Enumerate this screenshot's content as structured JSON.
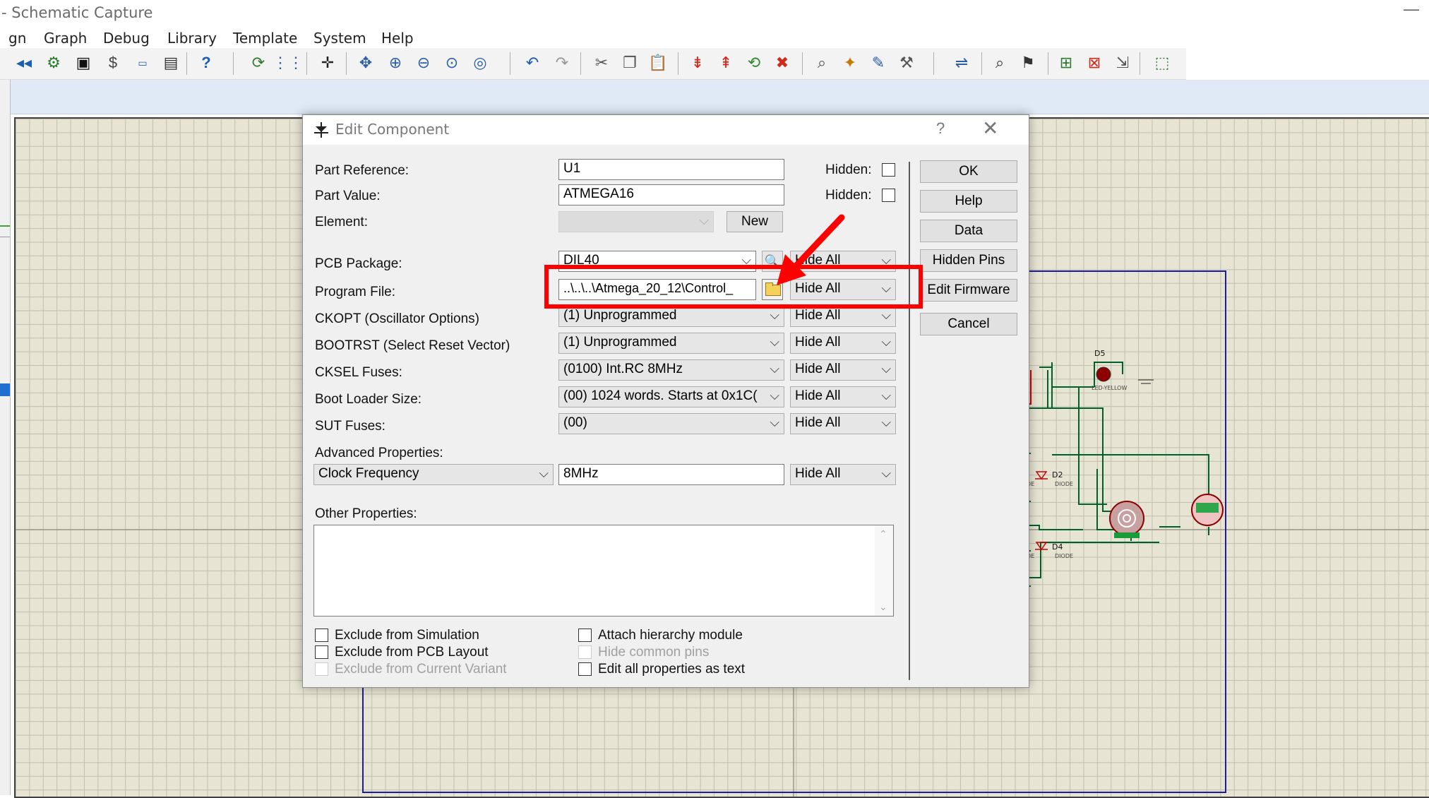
{
  "window": {
    "title": "- Schematic Capture",
    "minimize": "—"
  },
  "menu": [
    "gn",
    "Graph",
    "Debug",
    "Library",
    "Template",
    "System",
    "Help"
  ],
  "dialog": {
    "title": "Edit Component",
    "help_glyph": "?",
    "close_glyph": "✕",
    "part_reference": {
      "label": "Part Reference:",
      "value": "U1",
      "hidden_label": "Hidden:"
    },
    "part_value": {
      "label": "Part Value:",
      "value": "ATMEGA16",
      "hidden_label": "Hidden:"
    },
    "element": {
      "label": "Element:",
      "value": "",
      "new_button": "New"
    },
    "pcb_package": {
      "label": "PCB Package:",
      "value": "DIL40",
      "visibility": "Hide All"
    },
    "program_file": {
      "label": "Program File:",
      "value": "..\\..\\..\\Atmega_20_12\\Control_",
      "visibility": "Hide All"
    },
    "ckopt": {
      "label": "CKOPT (Oscillator Options)",
      "value": "(1) Unprogrammed",
      "visibility": "Hide All"
    },
    "bootrst": {
      "label": "BOOTRST (Select Reset Vector)",
      "value": "(1) Unprogrammed",
      "visibility": "Hide All"
    },
    "cksel": {
      "label": "CKSEL Fuses:",
      "value": "(0100) Int.RC 8MHz",
      "visibility": "Hide All"
    },
    "boot_loader": {
      "label": "Boot Loader Size:",
      "value": "(00) 1024 words. Starts at 0x1C(",
      "visibility": "Hide All"
    },
    "sut": {
      "label": "SUT Fuses:",
      "value": "(00)",
      "visibility": "Hide All"
    },
    "advanced": {
      "label": "Advanced Properties:",
      "property": "Clock Frequency",
      "value": "8MHz",
      "visibility": "Hide All"
    },
    "other_properties_label": "Other Properties:",
    "buttons": {
      "ok": "OK",
      "help": "Help",
      "data": "Data",
      "hidden_pins": "Hidden Pins",
      "edit_firmware": "Edit Firmware",
      "cancel": "Cancel"
    },
    "checkboxes": {
      "exclude_sim": "Exclude from Simulation",
      "exclude_pcb": "Exclude from PCB Layout",
      "exclude_variant": "Exclude from Current Variant",
      "attach_hierarchy": "Attach hierarchy module",
      "hide_common_pins": "Hide common pins",
      "edit_as_text": "Edit all properties as text"
    }
  },
  "schematic": {
    "d5_label": "D5",
    "d5_value": "LED-YELLOW",
    "d2_label": "D2",
    "d2_value": "DIODE",
    "d4_label": "D4",
    "d4_value": "DIODE",
    "frag_a": "DE",
    "frag_b": "DE"
  },
  "colors": {
    "annotation_red": "#ff0000",
    "wire_blue": "#1c1c9c",
    "grid_bg": "#e7e4d3"
  }
}
